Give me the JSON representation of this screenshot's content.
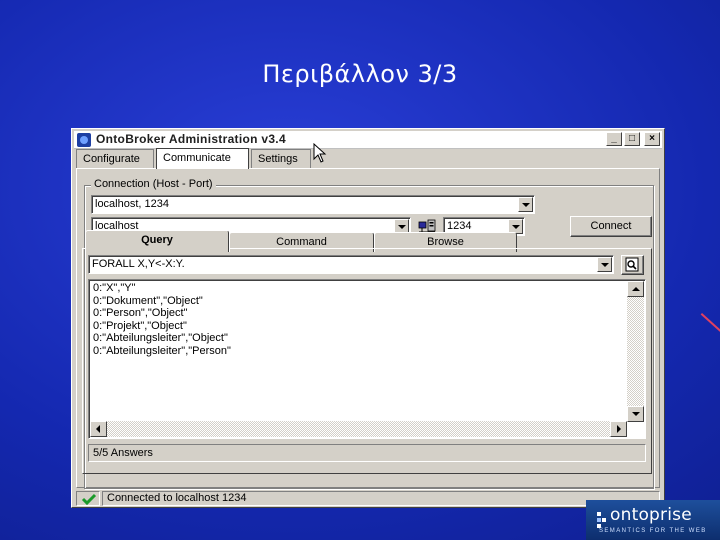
{
  "slide": {
    "title": "Περιβάλλον 3/3"
  },
  "window": {
    "title": "OntoBroker Administration v3.4",
    "controls": {
      "minimize": "_",
      "maximize": "□",
      "close": "×"
    },
    "tabs": [
      {
        "label": "Configurate"
      },
      {
        "label": "Communicate",
        "active": true
      },
      {
        "label": "Settings"
      }
    ]
  },
  "connection": {
    "legend": "Connection (Host - Port)",
    "history_value": "localhost, 1234",
    "host_value": "localhost",
    "port_value": "1234",
    "connect_label": "Connect"
  },
  "subtabs": [
    {
      "label": "Query",
      "active": true
    },
    {
      "label": "Command"
    },
    {
      "label": "Browse"
    }
  ],
  "query": {
    "input_value": "FORALL X,Y<-X:Y.",
    "results": [
      "0:\"X\",\"Y\"",
      "0:\"Dokument\",\"Object\"",
      "0:\"Person\",\"Object\"",
      "0:\"Projekt\",\"Object\"",
      "0:\"Abteilungsleiter\",\"Object\"",
      "0:\"Abteilungsleiter\",\"Person\""
    ],
    "answers": "5/5 Answers"
  },
  "status": {
    "text": "Connected to localhost 1234",
    "icon": "check-icon",
    "icon_color": "#1a9a2a"
  },
  "logo": {
    "name": "ontoprise",
    "tagline": "SEMANTICS FOR THE WEB"
  }
}
